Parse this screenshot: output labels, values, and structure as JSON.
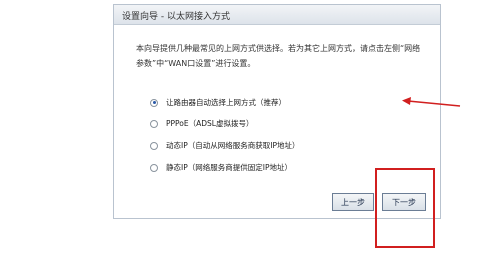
{
  "dialog": {
    "title": "设置向导 - 以太网接入方式",
    "description": "本向导提供几种最常见的上网方式供选择。若为其它上网方式，请点击左侧“网络参数”中“WAN口设置”进行设置。"
  },
  "options": [
    {
      "label": "让路由器自动选择上网方式（推荐）",
      "selected": true
    },
    {
      "label": "PPPoE（ADSL虚拟拨号）",
      "selected": false
    },
    {
      "label": "动态IP（自动从网络服务商获取IP地址）",
      "selected": false
    },
    {
      "label": "静态IP（网络服务商提供固定IP地址）",
      "selected": false
    }
  ],
  "buttons": {
    "prev_label": "上一步",
    "next_label": "下一步"
  },
  "annotation": {
    "color": "#d11f1f"
  }
}
